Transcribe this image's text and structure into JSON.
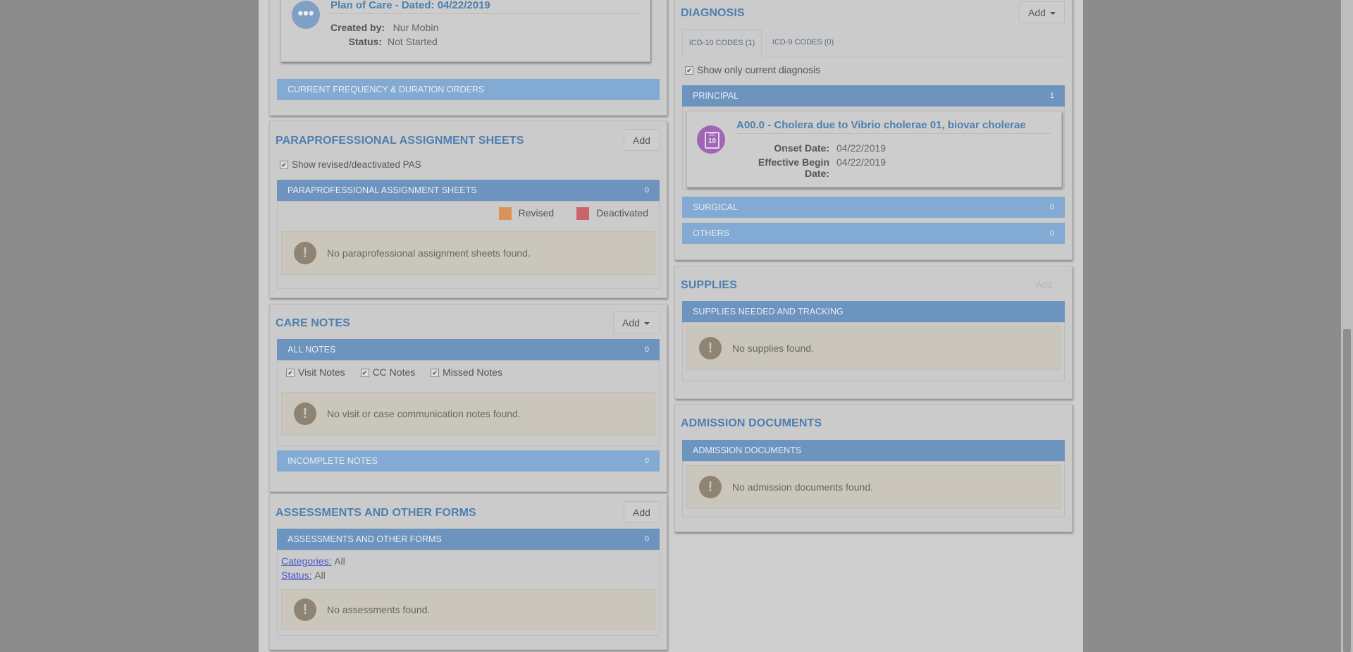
{
  "colors": {
    "accent": "#4d7fb1",
    "bar_dark": "#6d93bf",
    "bar_light": "#82aad2",
    "revised": "#d9925a",
    "deactivated": "#c9636c",
    "icd_icon": "#a066b3"
  },
  "plan_of_care": {
    "title": "Plan of Care - Dated: 04/22/2019",
    "created_by_label": "Created by:",
    "created_by": "Nur Mobin",
    "status_label": "Status:",
    "status": "Not Started",
    "icon": "more-dots-icon"
  },
  "frequency_bar": {
    "label": "CURRENT FREQUENCY & DURATION ORDERS"
  },
  "pas": {
    "title": "PARAPROFESSIONAL ASSIGNMENT SHEETS",
    "add_label": "Add",
    "show_revised_label": "Show revised/deactivated PAS",
    "bar_label": "PARAPROFESSIONAL ASSIGNMENT SHEETS",
    "bar_count": "0",
    "legend_revised": "Revised",
    "legend_deactivated": "Deactivated",
    "empty": "No paraprofessional assignment sheets found."
  },
  "care_notes": {
    "title": "CARE NOTES",
    "add_label": "Add",
    "bar_label": "ALL NOTES",
    "bar_count": "0",
    "filter_visit": "Visit Notes",
    "filter_cc": "CC Notes",
    "filter_missed": "Missed Notes",
    "empty": "No visit or case communication notes found.",
    "incomplete_label": "INCOMPLETE NOTES",
    "incomplete_count": "0"
  },
  "assessments": {
    "title": "ASSESSMENTS AND OTHER FORMS",
    "add_label": "Add",
    "bar_label": "ASSESSMENTS AND OTHER FORMS",
    "bar_count": "0",
    "categories_label": "Categories:",
    "categories_value": "All",
    "status_label": "Status:",
    "status_value": "All",
    "empty": "No assessments found."
  },
  "diagnosis": {
    "title": "DIAGNOSIS",
    "add_label": "Add",
    "tabs": [
      {
        "label": "ICD-10 CODES (1)"
      },
      {
        "label": "ICD-9 CODES (0)"
      }
    ],
    "show_current_label": "Show only current diagnosis",
    "principal_label": "PRINCIPAL",
    "principal_count": "1",
    "entry_title": "A00.0 - Cholera due to Vibrio cholerae 01, biovar cholerae",
    "onset_label": "Onset Date:",
    "onset_value": "04/22/2019",
    "effective_label": "Effective Begin Date:",
    "effective_value": "04/22/2019",
    "icd_icon_text": "10",
    "icd_icon_top": "ICD",
    "surgical_label": "SURGICAL",
    "surgical_count": "0",
    "others_label": "OTHERS",
    "others_count": "0"
  },
  "supplies": {
    "title": "SUPPLIES",
    "add_label": "Add",
    "bar_label": "SUPPLIES NEEDED AND TRACKING",
    "empty": "No supplies found."
  },
  "admission": {
    "title": "ADMISSION DOCUMENTS",
    "bar_label": "ADMISSION DOCUMENTS",
    "empty": "No admission documents found."
  }
}
